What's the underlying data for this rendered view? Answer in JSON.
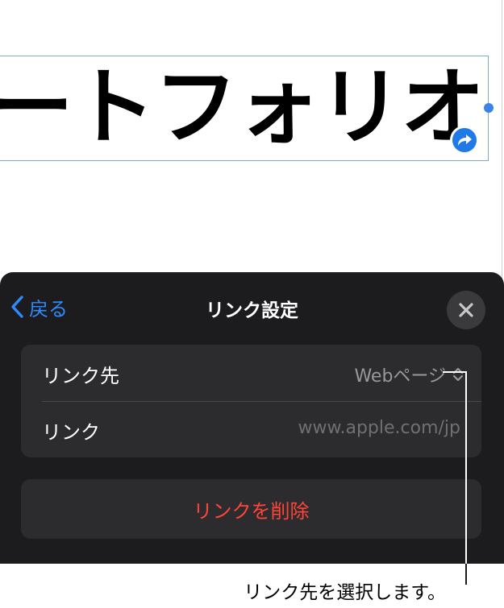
{
  "document": {
    "title_text": "ートフォリオ"
  },
  "icons": {
    "link_badge": "link-arrow-icon",
    "back": "chevron-left-icon",
    "close": "close-icon",
    "stepper": "chevron-up-down-icon"
  },
  "sheet": {
    "back_label": "戻る",
    "title": "リンク設定",
    "rows": [
      {
        "label": "リンク先",
        "value": "Webページ"
      },
      {
        "label": "リンク",
        "placeholder": "www.apple.com/jp"
      }
    ],
    "delete_label": "リンクを削除"
  },
  "callout": {
    "text": "リンク先を選択します。"
  },
  "colors": {
    "accent": "#2e8bff",
    "destructive": "#ff453a",
    "sheet_bg": "#1c1c1e",
    "group_bg": "#2c2c2e",
    "selection": "#7aa6e6"
  }
}
